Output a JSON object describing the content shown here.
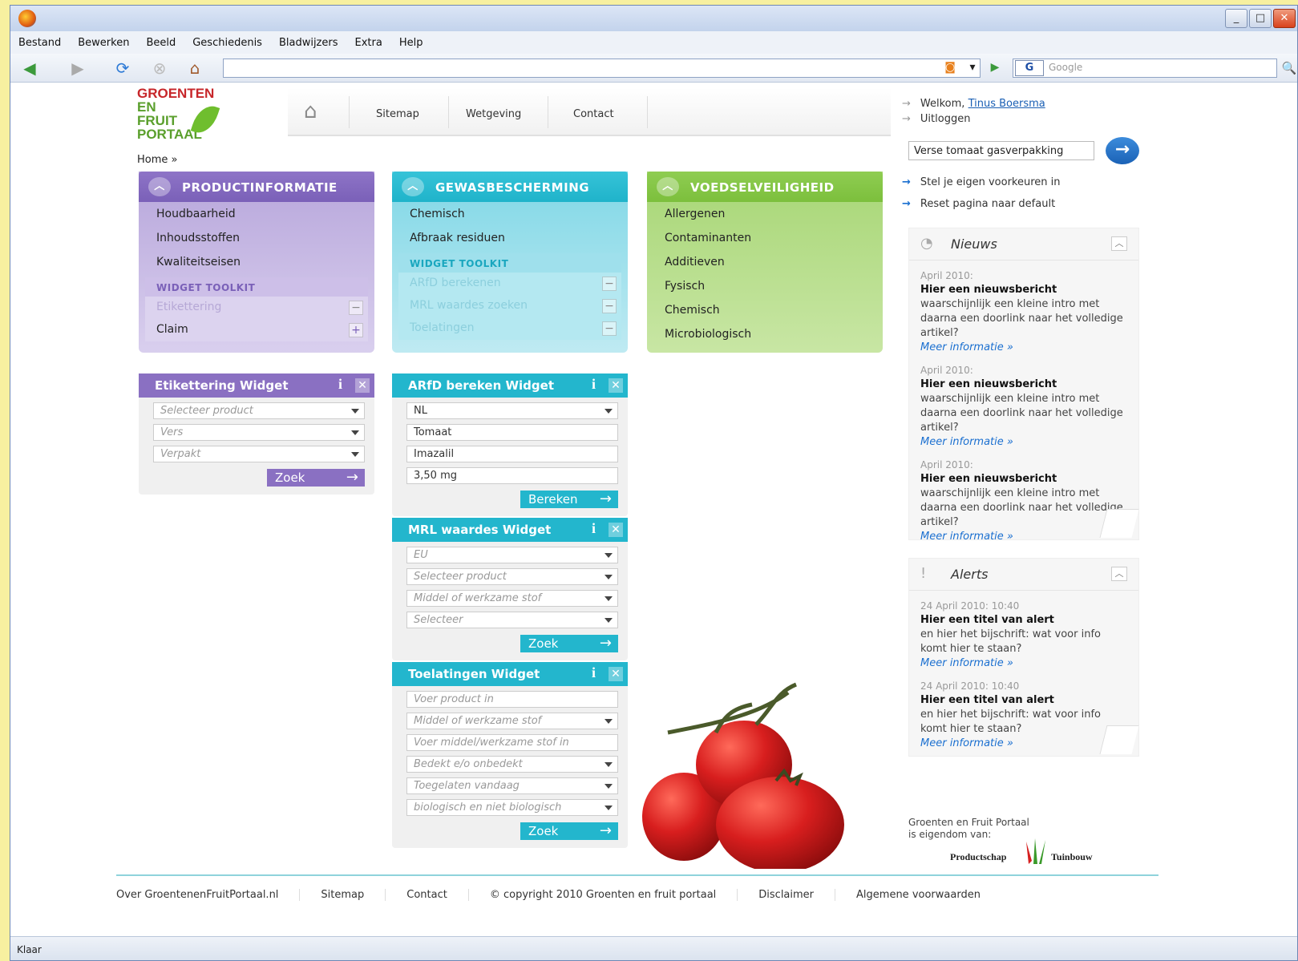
{
  "browser": {
    "menu": [
      "Bestand",
      "Bewerken",
      "Beeld",
      "Geschiedenis",
      "Bladwijzers",
      "Extra",
      "Help"
    ],
    "search_placeholder": "Google",
    "search_engine_letter": "G",
    "window_buttons": {
      "min": "_",
      "max": "□",
      "close": "✕"
    },
    "status": "Klaar"
  },
  "site": {
    "logo": {
      "l1": "GROENTEN",
      "l2": "EN",
      "l3": "FRUIT",
      "l4": "PORTAAL"
    },
    "nav": [
      "Sitemap",
      "Wetgeving",
      "Contact"
    ],
    "user": {
      "welcome": "Welkom,",
      "name": "Tinus Boersma",
      "logout": "Uitloggen"
    },
    "breadcrumb": "Home »",
    "search_value": "Verse tomaat gasverpakking",
    "prefs": [
      "Stel je eigen voorkeuren in",
      "Reset pagina naar default"
    ]
  },
  "categories": {
    "productinfo": {
      "title": "PRODUCTINFORMATIE",
      "items": [
        "Houdbaarheid",
        "Inhoudsstoffen",
        "Kwaliteitseisen"
      ],
      "toolkit": "WIDGET TOOLKIT",
      "widgets": [
        "Etikettering",
        "Claim"
      ]
    },
    "gewas": {
      "title": "GEWASBESCHERMING",
      "items": [
        "Chemisch",
        "Afbraak residuen"
      ],
      "toolkit": "WIDGET TOOLKIT",
      "widgets": [
        "ARfD berekenen",
        "MRL waardes zoeken",
        "Toelatingen"
      ]
    },
    "voedsel": {
      "title": "VOEDSELVEILIGHEID",
      "items": [
        "Allergenen",
        "Contaminanten",
        "Additieven",
        "Fysisch",
        "Chemisch",
        "Microbiologisch"
      ]
    }
  },
  "widgets": {
    "etikettering": {
      "title": "Etikettering Widget",
      "f1": "Selecteer product",
      "f2": "Vers",
      "f3": "Verpakt",
      "button": "Zoek"
    },
    "arfd": {
      "title": "ARfD bereken Widget",
      "f1": "NL",
      "f2": "Tomaat",
      "f3": "Imazalil",
      "f4": "3,50 mg",
      "button": "Bereken"
    },
    "mrl": {
      "title": "MRL waardes Widget",
      "f1": "EU",
      "f2": "Selecteer product",
      "f3": "Middel of werkzame stof",
      "f4": "Selecteer",
      "button": "Zoek"
    },
    "toel": {
      "title": "Toelatingen Widget",
      "f1": "Voer product in",
      "f2": "Middel of werkzame stof",
      "f3": "Voer middel/werkzame stof in",
      "f4": "Bedekt e/o onbedekt",
      "f5": "Toegelaten vandaag",
      "f6": "biologisch en niet biologisch",
      "button": "Zoek"
    }
  },
  "news": {
    "title": "Nieuws",
    "items": [
      {
        "date": "April 2010:",
        "title": "Hier een nieuwsbericht",
        "body": "waarschijnlijk een kleine intro met daarna een doorlink naar het volledige artikel?",
        "more": "Meer informatie »"
      },
      {
        "date": "April 2010:",
        "title": "Hier een nieuwsbericht",
        "body": "waarschijnlijk een kleine intro met daarna een doorlink naar het volledige artikel?",
        "more": "Meer informatie »"
      },
      {
        "date": "April 2010:",
        "title": "Hier een nieuwsbericht",
        "body": "waarschijnlijk een kleine intro met daarna een doorlink naar het volledige artikel?",
        "more": "Meer informatie »"
      }
    ]
  },
  "alerts": {
    "title": "Alerts",
    "items": [
      {
        "date": "24 April 2010: 10:40",
        "title": "Hier een titel van alert",
        "body": "en hier het bijschrift: wat voor info komt hier te staan?",
        "more": "Meer informatie »"
      },
      {
        "date": "24 April 2010: 10:40",
        "title": "Hier een titel van alert",
        "body": "en hier het bijschrift: wat voor info komt hier te staan?",
        "more": "Meer informatie »"
      }
    ]
  },
  "owner": {
    "l1": "Groenten en Fruit Portaal",
    "l2": "is eigendom van:",
    "left": "Productschap",
    "right": "Tuinbouw"
  },
  "footer": [
    "Over GroentenenFruitPortaal.nl",
    "Sitemap",
    "Contact",
    "© copyright 2010 Groenten en fruit portaal",
    "Disclaimer",
    "Algemene voorwaarden"
  ]
}
